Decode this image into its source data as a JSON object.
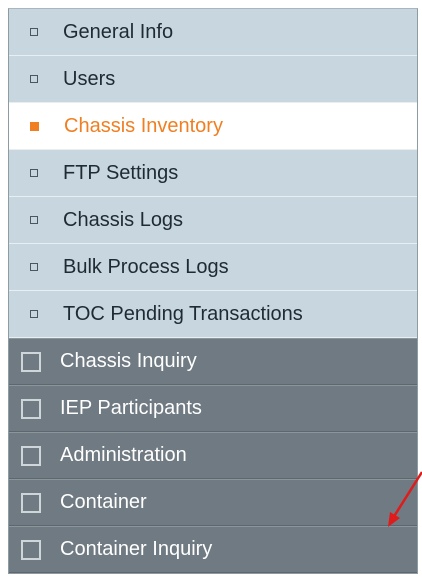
{
  "sub_menu": [
    {
      "label": "General Info",
      "active": false
    },
    {
      "label": "Users",
      "active": false
    },
    {
      "label": "Chassis Inventory",
      "active": true
    },
    {
      "label": "FTP Settings",
      "active": false
    },
    {
      "label": "Chassis Logs",
      "active": false
    },
    {
      "label": "Bulk Process Logs",
      "active": false
    },
    {
      "label": "TOC Pending Transactions",
      "active": false
    }
  ],
  "main_menu": [
    {
      "label": "Chassis Inquiry"
    },
    {
      "label": "IEP Participants"
    },
    {
      "label": "Administration"
    },
    {
      "label": "Container"
    },
    {
      "label": "Container Inquiry"
    }
  ],
  "colors": {
    "active_text": "#f07f22",
    "submenu_bg": "#c8d6df",
    "mainmenu_bg": "#6f7a82",
    "annotation_arrow": "#e01b1b"
  }
}
